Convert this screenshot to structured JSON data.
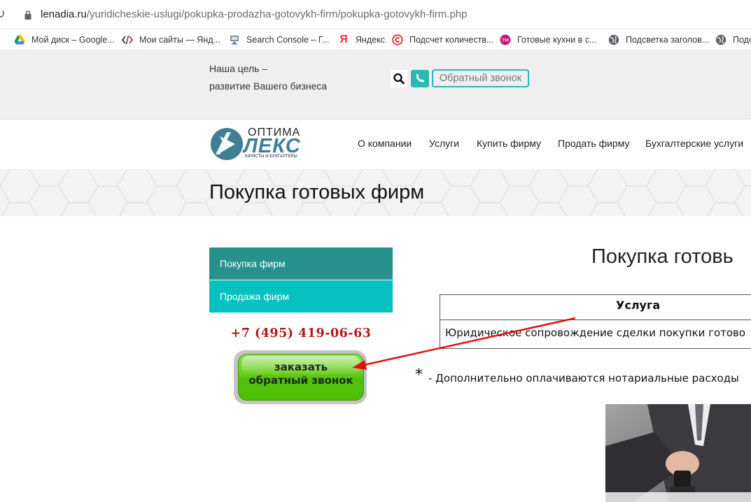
{
  "browser": {
    "url_domain": "lenadia.ru",
    "url_path": "/yuridicheskie-uslugi/pokupka-prodazha-gotovykh-firm/pokupka-gotovykh-firm.php",
    "bookmarks": [
      {
        "label": "Мой диск – Google...",
        "icon": "google-drive-icon"
      },
      {
        "label": "Мои сайты — Янд...",
        "icon": "code-icon"
      },
      {
        "label": "Search Console – Г...",
        "icon": "search-console-icon"
      },
      {
        "label": "Яндекс",
        "icon": "yandex-icon"
      },
      {
        "label": "Подсчет количеств...",
        "icon": "copyright-icon"
      },
      {
        "label": "Готовые кухни в с...",
        "icon": "tm-icon"
      },
      {
        "label": "Подсветка заголов...",
        "icon": "globe-icon"
      },
      {
        "label": "Подс",
        "icon": "globe-icon"
      }
    ]
  },
  "header": {
    "slogan_line1": "Наша цель –",
    "slogan_line2": "развитие Вашего бизнеса",
    "callback_label": "Обратный звонок"
  },
  "logo": {
    "top_text": "ОПТИМА",
    "main_text": "ЛЕКС",
    "tagline": "ЮРИСТЫ И БУХГАЛТЕРЫ"
  },
  "nav": {
    "items": [
      "О компании",
      "Услуги",
      "Купить фирму",
      "Продать фирму",
      "Бухгалтерские услуги"
    ]
  },
  "page": {
    "title": "Покупка готовых фирм"
  },
  "sidebar": {
    "items": [
      "Покупка фирм",
      "Продажа фирм"
    ],
    "phone": "+7 (495) 419-06-63",
    "callback_line1": "заказать",
    "callback_line2": "обратный звонок"
  },
  "content": {
    "heading": "Покупка готовь",
    "table_header": "Услуга",
    "table_cell": "Юридическое сопровождение сделки покупки готово",
    "note_star": "*",
    "note": "- Дополнительно оплачиваются нотариальные расходы"
  },
  "colors": {
    "teal_dark": "#27918e",
    "teal_light": "#07c0c0",
    "phone_red": "#b01818",
    "button_green": "#5cc712",
    "arrow_red": "#e01010"
  }
}
